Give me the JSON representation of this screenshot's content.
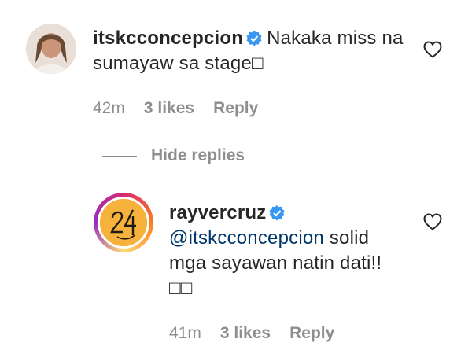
{
  "comments": [
    {
      "username": "itskcconcepcion",
      "text": "Nakaka miss na sumayaw sa stage□",
      "time": "42m",
      "likes": "3 likes",
      "reply_label": "Reply"
    },
    {
      "username": "rayvercruz",
      "mention": "@itskcconcepcion",
      "text": " solid mga sayawan natin dati!!",
      "emoji": "□□",
      "time": "41m",
      "likes": "3 likes",
      "reply_label": "Reply"
    }
  ],
  "hide_replies_label": "Hide replies",
  "icons": {
    "verified": "verified-badge-icon",
    "like": "heart-icon"
  },
  "colors": {
    "verified": "#3897f0",
    "mention": "#00376b",
    "meta": "#8e8e8e"
  }
}
